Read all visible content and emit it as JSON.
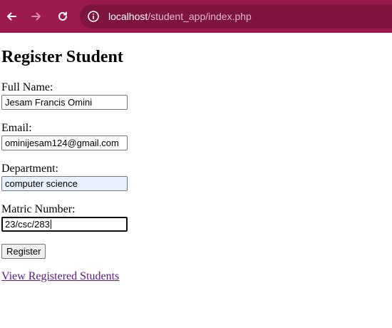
{
  "browser": {
    "url_host": "localhost",
    "url_path": "/student_app/index.php",
    "toolbar_color": "#9c1a4f",
    "icons": [
      "back-arrow-icon",
      "forward-arrow-icon",
      "reload-icon",
      "site-info-icon"
    ]
  },
  "form": {
    "title": "Register Student",
    "fields": [
      {
        "label": "Full Name:",
        "value": "Jesam Francis Omini"
      },
      {
        "label": "Email:",
        "value": "ominijesam124@gmail.com"
      },
      {
        "label": "Department:",
        "value": "computer science"
      },
      {
        "label": "Matric Number:",
        "value": "23/csc/283"
      }
    ],
    "submit_label": "Register"
  },
  "view_link": "View Registered Students"
}
